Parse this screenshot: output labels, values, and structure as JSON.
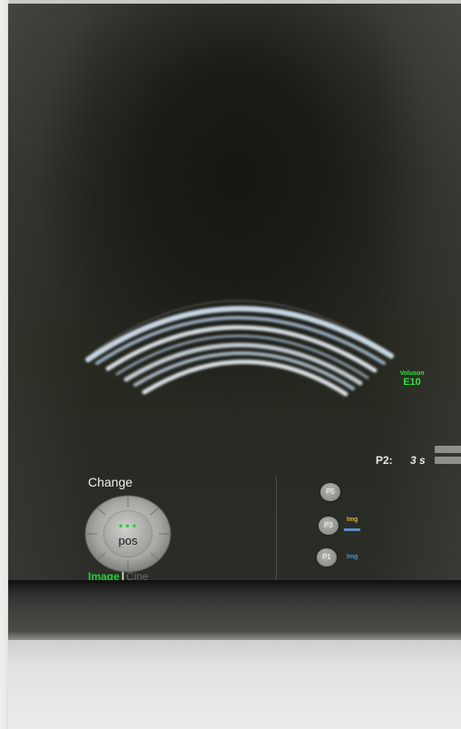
{
  "probe": {
    "brand": "Voluson",
    "model": "E10"
  },
  "param": {
    "label": "P2:",
    "value": "3 s"
  },
  "knob": {
    "title": "Change",
    "indicator": "•••",
    "label": "pos"
  },
  "mode": {
    "active": "Image",
    "separator": "|",
    "inactive": "Cine"
  },
  "p_buttons": [
    {
      "label": "P5",
      "tag": ""
    },
    {
      "label": "P3",
      "tag": "Img"
    },
    {
      "label": "P1",
      "tag": "Img"
    }
  ],
  "colors": {
    "accent_green": "#1ed236",
    "tag_yellow": "#e3b42a",
    "tag_blue": "#2f9be8"
  }
}
